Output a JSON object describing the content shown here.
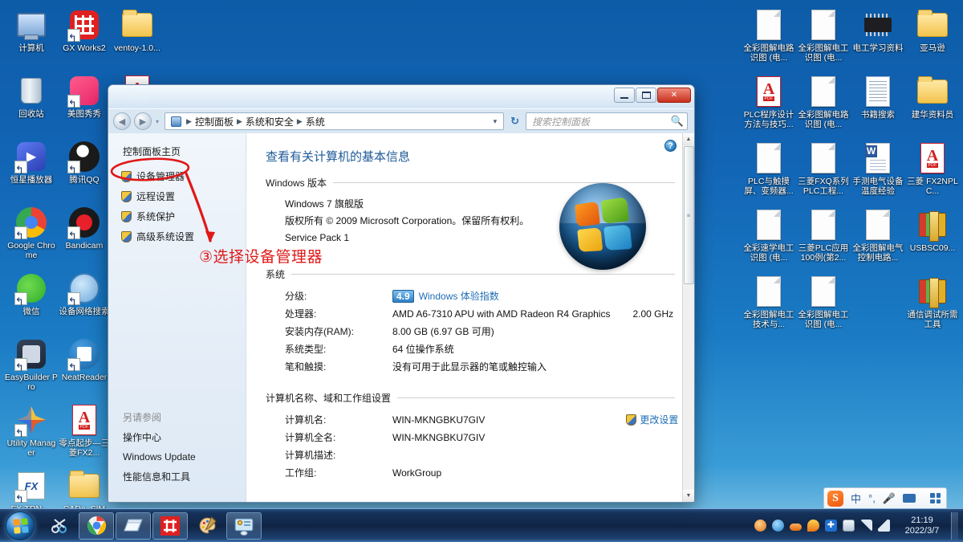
{
  "desktop": {
    "left_icons": [
      {
        "label": "计算机",
        "icon": "computer-icon",
        "shortcut": false
      },
      {
        "label": "GX Works2",
        "icon": "gx-works2-icon",
        "shortcut": true
      },
      {
        "label": "ventoy-1.0...",
        "icon": "folder-icon",
        "shortcut": false
      },
      {
        "label": "回收站",
        "icon": "recycle-bin-icon",
        "shortcut": false
      },
      {
        "label": "美图秀秀",
        "icon": "meitu-icon",
        "shortcut": true
      },
      {
        "label": "",
        "icon": "pdf-file-icon",
        "shortcut": false
      },
      {
        "label": "恒星播放器",
        "icon": "player-icon",
        "shortcut": true
      },
      {
        "label": "腾讯QQ",
        "icon": "qq-penguin-icon",
        "shortcut": true
      },
      {
        "label": "",
        "icon": "blank-icon",
        "shortcut": false
      },
      {
        "label": "Google Chrome",
        "icon": "chrome-icon",
        "shortcut": true
      },
      {
        "label": "Bandicam",
        "icon": "bandicam-icon",
        "shortcut": true
      },
      {
        "label": "",
        "icon": "blank-icon",
        "shortcut": false
      },
      {
        "label": "微信",
        "icon": "wechat-icon",
        "shortcut": true
      },
      {
        "label": "设备网络搜索",
        "icon": "network-search-icon",
        "shortcut": true
      },
      {
        "label": "",
        "icon": "blank-icon",
        "shortcut": false
      },
      {
        "label": "EasyBuilder Pro",
        "icon": "easybuilder-pro-icon",
        "shortcut": true
      },
      {
        "label": "NeatReader",
        "icon": "neatreader-icon",
        "shortcut": true
      },
      {
        "label": "",
        "icon": "blank-icon",
        "shortcut": false
      },
      {
        "label": "Utility Manager",
        "icon": "utility-manager-icon",
        "shortcut": true
      },
      {
        "label": "零点起步—三菱FX2...",
        "icon": "pdf-file-icon",
        "shortcut": false
      },
      {
        "label": "",
        "icon": "blank-icon",
        "shortcut": false
      },
      {
        "label": "FX-TRN-...",
        "icon": "fx-trn-icon",
        "shortcut": true
      },
      {
        "label": "CADe_SIM",
        "icon": "folder-icon",
        "shortcut": false
      },
      {
        "label": "",
        "icon": "blank-icon",
        "shortcut": false
      }
    ],
    "right_icons": [
      {
        "label": "全彩图解电路识图 (电...",
        "icon": "document-icon",
        "shortcut": false
      },
      {
        "label": "全彩图解电工识图 (电...",
        "icon": "document-icon",
        "shortcut": false
      },
      {
        "label": "电工学习资料",
        "icon": "chip-icon",
        "shortcut": false
      },
      {
        "label": "亚马逊",
        "icon": "folder-icon",
        "shortcut": false
      },
      {
        "label": "PLC程序设计方法与技巧...",
        "icon": "pdf-file-icon",
        "shortcut": false
      },
      {
        "label": "全彩图解电路识图 (电...",
        "icon": "document-icon",
        "shortcut": false
      },
      {
        "label": "书籍搜索",
        "icon": "text-document-icon",
        "shortcut": false
      },
      {
        "label": "建华资料员",
        "icon": "folder-open-icon",
        "shortcut": false
      },
      {
        "label": "PLC与触摸屏、变频器...",
        "icon": "document-icon",
        "shortcut": false
      },
      {
        "label": "三菱FXQ系列PLC工程...",
        "icon": "document-icon",
        "shortcut": false
      },
      {
        "label": "手测电气设备温度经验",
        "icon": "word-document-icon",
        "shortcut": false
      },
      {
        "label": "三菱 FX2NPLC...",
        "icon": "pdf-file-icon",
        "shortcut": false
      },
      {
        "label": "全彩速学电工识图 (电...",
        "icon": "document-icon",
        "shortcut": false
      },
      {
        "label": "三菱PLC应用100例(第2...",
        "icon": "document-icon",
        "shortcut": false
      },
      {
        "label": "全彩图解电气控制电路...",
        "icon": "document-icon",
        "shortcut": false
      },
      {
        "label": "USBSC09...",
        "icon": "winrar-archive-icon",
        "shortcut": false
      },
      {
        "label": "全彩图解电工技术与...",
        "icon": "document-icon",
        "shortcut": false
      },
      {
        "label": "全彩图解电工识图 (电...",
        "icon": "document-icon",
        "shortcut": false
      },
      {
        "label": "",
        "icon": "blank-icon",
        "shortcut": false
      },
      {
        "label": "通信调试所需工具",
        "icon": "winrar-archive-icon",
        "shortcut": false
      }
    ]
  },
  "window": {
    "controls": {
      "minimize": "–",
      "maximize": "□",
      "close": "✕"
    },
    "nav": {
      "back_title": "后退",
      "forward_title": "前进",
      "breadcrumbs": [
        "控制面板",
        "系统和安全",
        "系统"
      ],
      "dropdown": "▼",
      "refresh": "↻"
    },
    "search": {
      "placeholder": "搜索控制面板",
      "value": ""
    },
    "sidebar": {
      "home": "控制面板主页",
      "items": [
        {
          "label": "设备管理器"
        },
        {
          "label": "远程设置"
        },
        {
          "label": "系统保护"
        },
        {
          "label": "高级系统设置"
        }
      ],
      "also_see_header": "另请参阅",
      "also_see": [
        "操作中心",
        "Windows Update",
        "性能信息和工具"
      ]
    },
    "content": {
      "title": "查看有关计算机的基本信息",
      "help_label": "?",
      "sections": [
        {
          "heading": "Windows 版本",
          "lines": [
            "Windows 7 旗舰版",
            "版权所有 © 2009 Microsoft Corporation。保留所有权利。",
            "Service Pack 1"
          ]
        },
        {
          "heading": "系统",
          "rows": [
            {
              "key": "分级:",
              "value": "Windows 体验指数",
              "badge": "4.9",
              "is_link": true
            },
            {
              "key": "处理器:",
              "value": "AMD A6-7310 APU with AMD Radeon R4 Graphics",
              "extra": "2.00 GHz"
            },
            {
              "key": "安装内存(RAM):",
              "value": "8.00 GB (6.97 GB 可用)"
            },
            {
              "key": "系统类型:",
              "value": "64 位操作系统"
            },
            {
              "key": "笔和触摸:",
              "value": "没有可用于此显示器的笔或触控输入"
            }
          ]
        },
        {
          "heading": "计算机名称、域和工作组设置",
          "rows": [
            {
              "key": "计算机名:",
              "value": "WIN-MKNGBKU7GIV",
              "action": "更改设置"
            },
            {
              "key": "计算机全名:",
              "value": "WIN-MKNGBKU7GIV"
            },
            {
              "key": "计算机描述:",
              "value": ""
            },
            {
              "key": "工作组:",
              "value": "WorkGroup"
            }
          ]
        }
      ]
    }
  },
  "annotation": {
    "text": "③选择设备管理器",
    "color": "#e01818"
  },
  "taskbar": {
    "start_label": "开始",
    "pinned": [
      {
        "name": "snipping-tool-icon",
        "label": "截图工具"
      },
      {
        "name": "chrome-icon",
        "label": "Google Chrome"
      },
      {
        "name": "explorer-icon",
        "label": "Windows 资源管理器"
      },
      {
        "name": "gx-works2-icon",
        "label": "GX Works2"
      },
      {
        "name": "paint-icon",
        "label": "画图"
      },
      {
        "name": "control-panel-icon",
        "label": "控制面板"
      }
    ],
    "tray_icons": [
      "coffee-tray-icon",
      "mail-tray-icon",
      "orange-tray-icon",
      "flame-tray-icon",
      "bluetooth-tray-icon",
      "device-tray-icon",
      "network-tray-icon",
      "volume-tray-icon"
    ],
    "clock": {
      "time": "21:19",
      "date": "2022/3/7"
    },
    "ime": {
      "logo": "S",
      "mode": "中",
      "items": [
        "punctuation-icon",
        "microphone-icon",
        "keyboard-icon",
        "skin-icon",
        "toolbox-icon"
      ]
    }
  }
}
